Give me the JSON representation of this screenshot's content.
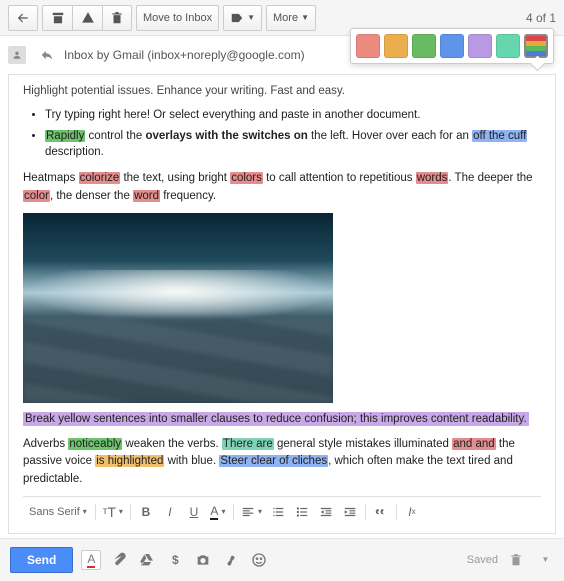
{
  "toolbar": {
    "move_label": "Move to Inbox",
    "more_label": "More",
    "page_counter": "4 of 1"
  },
  "header": {
    "sender": "Inbox by Gmail (inbox+noreply@google.com)"
  },
  "palette": {
    "colors": [
      "#ed8a80",
      "#eaae4f",
      "#68bb60",
      "#5e94ea",
      "#b79ae2",
      "#66d6ae"
    ]
  },
  "body": {
    "intro": "Highlight potential issues. Enhance your writing. Fast and easy.",
    "bullet1_text": "Try typing right here! Or select everything and paste in another document.",
    "bullet2_w1": "Rapidly",
    "bullet2_t1": " control the ",
    "bullet2_b1": "overlays with the switches on",
    "bullet2_t2": " the left. Hover over each for an ",
    "bullet2_w2": "off the cuff",
    "bullet2_t3": " description.",
    "para1_t1": "Heatmaps ",
    "para1_w1": "colorize",
    "para1_t2": " the text, using bright ",
    "para1_w2": "colors",
    "para1_t3": " to call attention to repetitious ",
    "para1_w3": "words",
    "para1_t4": ". The deeper the ",
    "para1_w4": "color",
    "para1_t5": ", the denser the ",
    "para1_w5": "word",
    "para1_t6": " frequency.",
    "purple_line": "Break yellow sentences into smaller clauses to reduce confusion; this improves content readability.",
    "para2_t1": "Adverbs ",
    "para2_w1": "noticeably",
    "para2_t2": " weaken the verbs. ",
    "para2_w2": "There are",
    "para2_t3": " general style mistakes illuminated ",
    "para2_w3": "and and",
    "para2_t4": " the passive voice ",
    "para2_w4": "is highlighted",
    "para2_t5": " with blue. ",
    "para2_w5": "Steer clear of cliches",
    "para2_t6": ", which often make the text tired and predictable."
  },
  "format_bar": {
    "font": "Sans Serif"
  },
  "footer": {
    "send": "Send",
    "saved": "Saved"
  }
}
